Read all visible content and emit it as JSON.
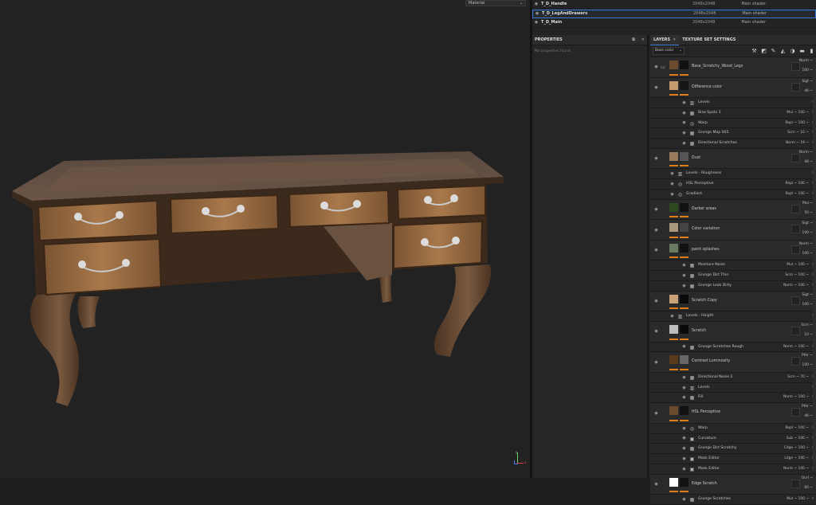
{
  "viewport": {
    "material_select": "Material",
    "axis_x": "x",
    "axis_y": "y"
  },
  "texture_sets": [
    {
      "name": "T_D_Handle",
      "res": "2048x2048",
      "shader": "Main shader",
      "selected": false
    },
    {
      "name": "T_D_LegAndDrawers",
      "res": "2048x2048",
      "shader": "Main shader",
      "selected": true
    },
    {
      "name": "T_D_Main",
      "res": "2048x2048",
      "shader": "Main shader",
      "selected": false
    }
  ],
  "properties": {
    "title": "PROPERTIES",
    "empty": "No properties found"
  },
  "layers_panel": {
    "tab_layers": "LAYERS",
    "tab_tss": "TEXTURE SET SETTINGS",
    "channel": "Base color",
    "rows": [
      {
        "t": "layer",
        "folder": true,
        "name": "Base_Scratchy_Wood_Legs",
        "b1": "Norm ~",
        "b2": "100 ~",
        "c1": "#6b4a2e",
        "c2": "#111"
      },
      {
        "t": "layer",
        "name": "Difference color",
        "b1": "Sigt ~",
        "b2": "46 ~",
        "c1": "#c49a6c",
        "c2": "#151515"
      },
      {
        "t": "eff",
        "icon": "▥",
        "name": "Levels",
        "blend": ""
      },
      {
        "t": "eff",
        "icon": "▦",
        "name": "Bnw Spots 3",
        "blend": "Mul ~  100 ~"
      },
      {
        "t": "eff",
        "icon": "◎",
        "name": "Warp",
        "blend": "Repl ~  100 ~"
      },
      {
        "t": "eff",
        "icon": "▦",
        "name": "Grunge Map 005",
        "blend": "Scrn ~  10 ~"
      },
      {
        "t": "eff",
        "icon": "▦",
        "name": "Directional Scratches",
        "blend": "Norm ~  19 ~"
      },
      {
        "t": "layer",
        "name": "Dust",
        "b1": "Norm ~",
        "b2": "48 ~",
        "c1": "#9a7a5c",
        "c2": "#555"
      },
      {
        "t": "eff",
        "sub": true,
        "icon": "▥",
        "name": "Levels - Roughness",
        "blend": ""
      },
      {
        "t": "eff",
        "sub": true,
        "icon": "◎",
        "name": "HSL Perceptive",
        "blend": "Repl ~  100 ~"
      },
      {
        "t": "eff",
        "sub": true,
        "icon": "◎",
        "name": "Gradient",
        "blend": "Repl ~  100 ~"
      },
      {
        "t": "layer",
        "name": "Darker areas",
        "b1": "Mul ~",
        "b2": "50 ~",
        "c1": "#2f4a22",
        "c2": "#111"
      },
      {
        "t": "layer",
        "name": "Color variation",
        "b1": "Sigt ~",
        "b2": "100 ~",
        "c1": "#a89880",
        "c2": "#444"
      },
      {
        "t": "layer",
        "name": "paint splashes",
        "b1": "Norm ~",
        "b2": "100 ~",
        "c1": "#6a7a60",
        "c2": "#111"
      },
      {
        "t": "eff",
        "icon": "▦",
        "name": "Moisture Noise",
        "blend": "Mul ~  100 ~"
      },
      {
        "t": "eff",
        "icon": "▦",
        "name": "Grunge Dirt Thin",
        "blend": "Scrn ~  100 ~"
      },
      {
        "t": "eff",
        "icon": "▦",
        "name": "Grunge Leak Dirty",
        "blend": "Norm ~  100 ~"
      },
      {
        "t": "layer",
        "name": "Scratch Copy",
        "b1": "Sigt ~",
        "b2": "100 ~",
        "c1": "#c9a27a",
        "c2": "#0a0a0a"
      },
      {
        "t": "eff",
        "sub": true,
        "icon": "▥",
        "name": "Levels - Height",
        "blend": ""
      },
      {
        "t": "layer",
        "name": "Scratch",
        "b1": "Scrn ~",
        "b2": "10 ~",
        "c1": "#bdbdbd",
        "c2": "#0a0a0a"
      },
      {
        "t": "eff",
        "icon": "▦",
        "name": "Grunge Scratches Rough",
        "blend": "Norm ~  100 ~"
      },
      {
        "t": "layer",
        "name": "Contrast Luminosity",
        "b1": "Pthr ~",
        "b2": "100 ~",
        "c1": "#5a3a1a",
        "c2": "#666"
      },
      {
        "t": "eff",
        "icon": "▦",
        "name": "Directional Noise 2",
        "blend": "Scrn ~  70 ~"
      },
      {
        "t": "eff",
        "icon": "▥",
        "name": "Levels",
        "blend": ""
      },
      {
        "t": "eff",
        "icon": "▦",
        "name": "Fill",
        "blend": "Norm ~  100 ~"
      },
      {
        "t": "layer",
        "name": "HSL Perceptive",
        "b1": "Pthr ~",
        "b2": "46 ~",
        "c1": "#6b4a2e",
        "c2": "#111"
      },
      {
        "t": "eff",
        "icon": "◎",
        "name": "Warp",
        "blend": "Repl ~  100 ~"
      },
      {
        "t": "eff",
        "icon": "▣",
        "name": "Curvature",
        "blend": "Sub ~  100 ~"
      },
      {
        "t": "eff",
        "icon": "▦",
        "name": "Grunge Dirt Scratchy",
        "blend": "Cdge ~  100 ~"
      },
      {
        "t": "eff",
        "icon": "▣",
        "name": "Mask Editor",
        "blend": "Ldge ~  100 ~"
      },
      {
        "t": "eff",
        "icon": "▣",
        "name": "Mask Editor",
        "blend": "Norm ~  100 ~"
      },
      {
        "t": "layer",
        "name": "Edge Scratch",
        "b1": "Ovrl ~",
        "b2": "60 ~",
        "c1": "#ffffff",
        "c2": "#111"
      },
      {
        "t": "eff",
        "icon": "▦",
        "name": "Grunge Scratches",
        "blend": "Mul ~  100 ~"
      }
    ]
  }
}
